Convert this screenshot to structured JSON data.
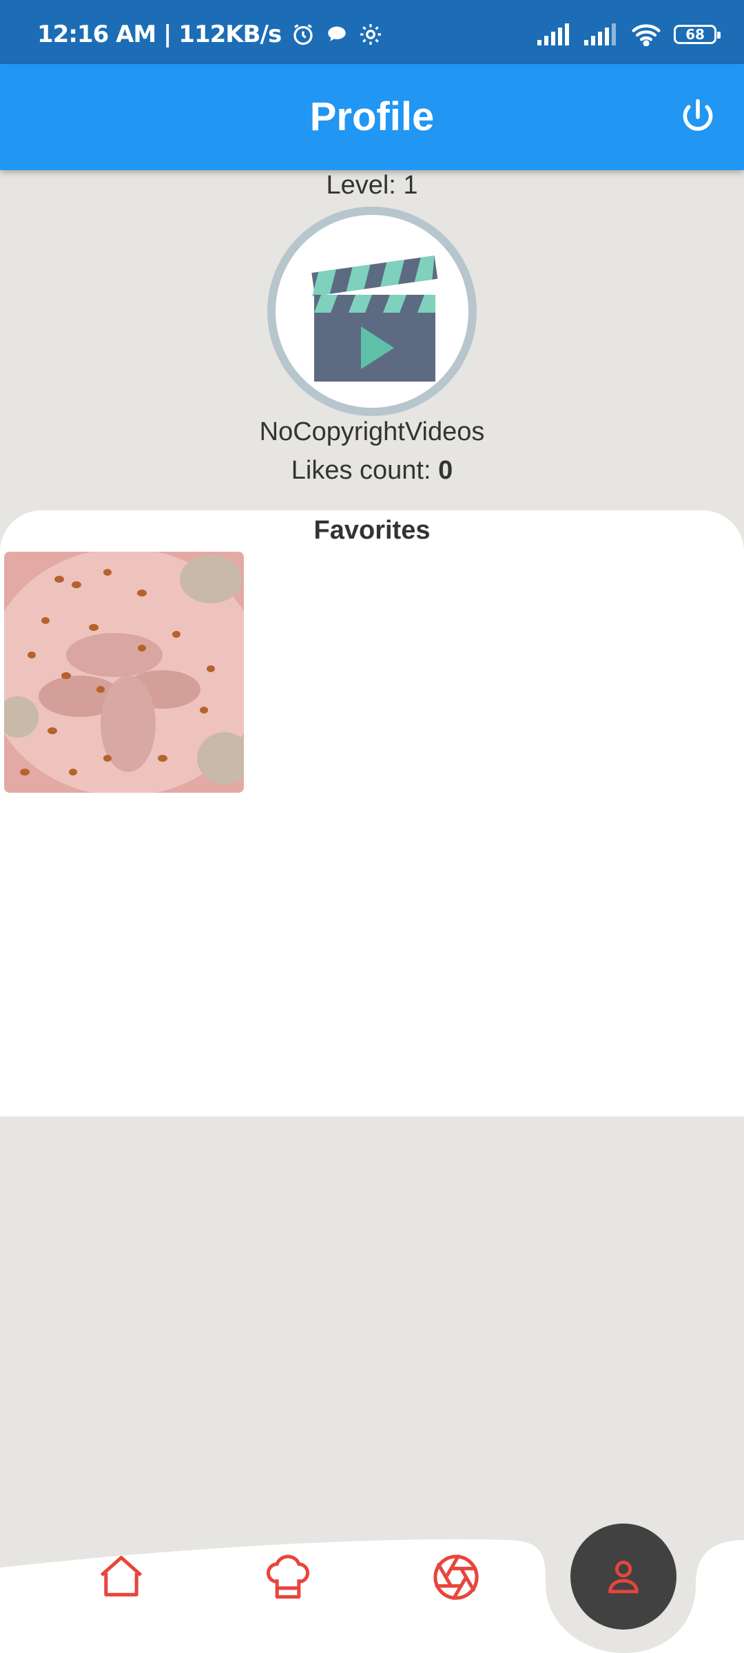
{
  "status_bar": {
    "time_speed": "12:16 AM | 112KB/s",
    "battery": "68",
    "icons": [
      "alarm-icon",
      "chat-bubble-icon",
      "settings-icon",
      "signal-icon",
      "signal-icon",
      "wifi-icon",
      "battery-icon"
    ]
  },
  "app_bar": {
    "title": "Profile",
    "action_icon": "power-icon"
  },
  "profile": {
    "level": "Level: 1",
    "username": "NoCopyrightVideos",
    "likes_label": "Likes count: ",
    "likes_value": "0"
  },
  "favorites": {
    "title": "Favorites",
    "items": [
      {
        "type": "recipe-thumbnail"
      }
    ]
  },
  "bottom_nav": {
    "items": [
      {
        "icon": "home-icon",
        "active": false
      },
      {
        "icon": "chef-hat-icon",
        "active": false
      },
      {
        "icon": "aperture-icon",
        "active": false
      },
      {
        "icon": "user-icon",
        "active": true
      }
    ]
  },
  "colors": {
    "status_bar": "#1c6db6",
    "app_bar": "#2196f3",
    "background": "#e6e5e2",
    "nav_icon": "#e8453c",
    "nav_active_bg": "#414141"
  }
}
